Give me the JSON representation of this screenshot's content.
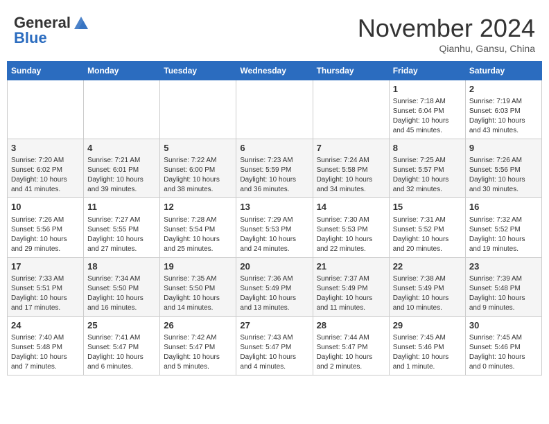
{
  "header": {
    "logo_line1": "General",
    "logo_line2": "Blue",
    "month": "November 2024",
    "location": "Qianhu, Gansu, China"
  },
  "weekdays": [
    "Sunday",
    "Monday",
    "Tuesday",
    "Wednesday",
    "Thursday",
    "Friday",
    "Saturday"
  ],
  "weeks": [
    [
      {
        "day": "",
        "info": ""
      },
      {
        "day": "",
        "info": ""
      },
      {
        "day": "",
        "info": ""
      },
      {
        "day": "",
        "info": ""
      },
      {
        "day": "",
        "info": ""
      },
      {
        "day": "1",
        "info": "Sunrise: 7:18 AM\nSunset: 6:04 PM\nDaylight: 10 hours and 45 minutes."
      },
      {
        "day": "2",
        "info": "Sunrise: 7:19 AM\nSunset: 6:03 PM\nDaylight: 10 hours and 43 minutes."
      }
    ],
    [
      {
        "day": "3",
        "info": "Sunrise: 7:20 AM\nSunset: 6:02 PM\nDaylight: 10 hours and 41 minutes."
      },
      {
        "day": "4",
        "info": "Sunrise: 7:21 AM\nSunset: 6:01 PM\nDaylight: 10 hours and 39 minutes."
      },
      {
        "day": "5",
        "info": "Sunrise: 7:22 AM\nSunset: 6:00 PM\nDaylight: 10 hours and 38 minutes."
      },
      {
        "day": "6",
        "info": "Sunrise: 7:23 AM\nSunset: 5:59 PM\nDaylight: 10 hours and 36 minutes."
      },
      {
        "day": "7",
        "info": "Sunrise: 7:24 AM\nSunset: 5:58 PM\nDaylight: 10 hours and 34 minutes."
      },
      {
        "day": "8",
        "info": "Sunrise: 7:25 AM\nSunset: 5:57 PM\nDaylight: 10 hours and 32 minutes."
      },
      {
        "day": "9",
        "info": "Sunrise: 7:26 AM\nSunset: 5:56 PM\nDaylight: 10 hours and 30 minutes."
      }
    ],
    [
      {
        "day": "10",
        "info": "Sunrise: 7:26 AM\nSunset: 5:56 PM\nDaylight: 10 hours and 29 minutes."
      },
      {
        "day": "11",
        "info": "Sunrise: 7:27 AM\nSunset: 5:55 PM\nDaylight: 10 hours and 27 minutes."
      },
      {
        "day": "12",
        "info": "Sunrise: 7:28 AM\nSunset: 5:54 PM\nDaylight: 10 hours and 25 minutes."
      },
      {
        "day": "13",
        "info": "Sunrise: 7:29 AM\nSunset: 5:53 PM\nDaylight: 10 hours and 24 minutes."
      },
      {
        "day": "14",
        "info": "Sunrise: 7:30 AM\nSunset: 5:53 PM\nDaylight: 10 hours and 22 minutes."
      },
      {
        "day": "15",
        "info": "Sunrise: 7:31 AM\nSunset: 5:52 PM\nDaylight: 10 hours and 20 minutes."
      },
      {
        "day": "16",
        "info": "Sunrise: 7:32 AM\nSunset: 5:52 PM\nDaylight: 10 hours and 19 minutes."
      }
    ],
    [
      {
        "day": "17",
        "info": "Sunrise: 7:33 AM\nSunset: 5:51 PM\nDaylight: 10 hours and 17 minutes."
      },
      {
        "day": "18",
        "info": "Sunrise: 7:34 AM\nSunset: 5:50 PM\nDaylight: 10 hours and 16 minutes."
      },
      {
        "day": "19",
        "info": "Sunrise: 7:35 AM\nSunset: 5:50 PM\nDaylight: 10 hours and 14 minutes."
      },
      {
        "day": "20",
        "info": "Sunrise: 7:36 AM\nSunset: 5:49 PM\nDaylight: 10 hours and 13 minutes."
      },
      {
        "day": "21",
        "info": "Sunrise: 7:37 AM\nSunset: 5:49 PM\nDaylight: 10 hours and 11 minutes."
      },
      {
        "day": "22",
        "info": "Sunrise: 7:38 AM\nSunset: 5:49 PM\nDaylight: 10 hours and 10 minutes."
      },
      {
        "day": "23",
        "info": "Sunrise: 7:39 AM\nSunset: 5:48 PM\nDaylight: 10 hours and 9 minutes."
      }
    ],
    [
      {
        "day": "24",
        "info": "Sunrise: 7:40 AM\nSunset: 5:48 PM\nDaylight: 10 hours and 7 minutes."
      },
      {
        "day": "25",
        "info": "Sunrise: 7:41 AM\nSunset: 5:47 PM\nDaylight: 10 hours and 6 minutes."
      },
      {
        "day": "26",
        "info": "Sunrise: 7:42 AM\nSunset: 5:47 PM\nDaylight: 10 hours and 5 minutes."
      },
      {
        "day": "27",
        "info": "Sunrise: 7:43 AM\nSunset: 5:47 PM\nDaylight: 10 hours and 4 minutes."
      },
      {
        "day": "28",
        "info": "Sunrise: 7:44 AM\nSunset: 5:47 PM\nDaylight: 10 hours and 2 minutes."
      },
      {
        "day": "29",
        "info": "Sunrise: 7:45 AM\nSunset: 5:46 PM\nDaylight: 10 hours and 1 minute."
      },
      {
        "day": "30",
        "info": "Sunrise: 7:45 AM\nSunset: 5:46 PM\nDaylight: 10 hours and 0 minutes."
      }
    ]
  ]
}
